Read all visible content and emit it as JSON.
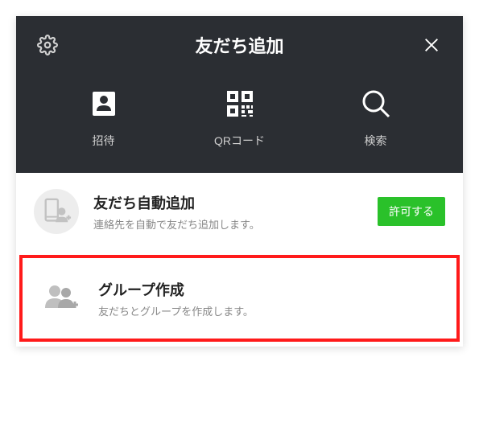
{
  "header": {
    "title": "友だち追加"
  },
  "tabs": {
    "invite": {
      "label": "招待"
    },
    "qrcode": {
      "label": "QRコード"
    },
    "search": {
      "label": "検索"
    }
  },
  "items": {
    "autoAdd": {
      "title": "友だち自動追加",
      "description": "連絡先を自動で友だち追加します。",
      "button": "許可する"
    },
    "createGroup": {
      "title": "グループ作成",
      "description": "友だちとグループを作成します。"
    }
  }
}
